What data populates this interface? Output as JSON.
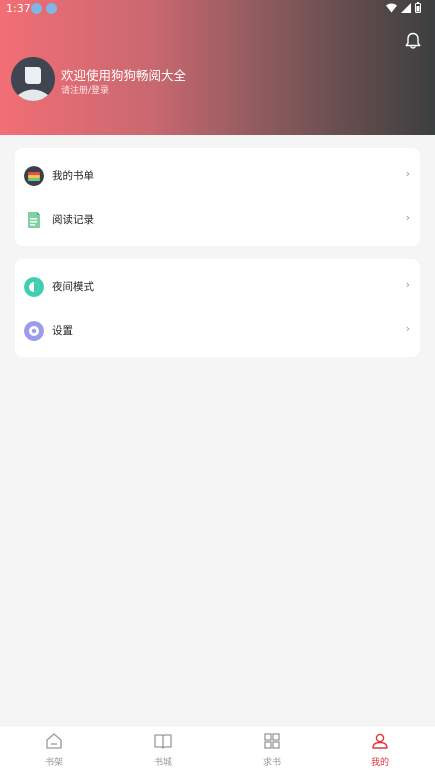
{
  "status_bar": {
    "time": "1:37"
  },
  "profile": {
    "welcome_text": "欢迎使用狗狗畅阅大全",
    "login_text": "请注册/登录"
  },
  "menu_group_1": [
    {
      "label": "我的书单",
      "icon": "book-list-icon"
    },
    {
      "label": "阅读记录",
      "icon": "reading-history-icon"
    }
  ],
  "menu_group_2": [
    {
      "label": "夜间模式",
      "icon": "night-mode-icon"
    },
    {
      "label": "设置",
      "icon": "settings-icon"
    }
  ],
  "tab_bar": [
    {
      "label": "书架",
      "icon": "bookshelf-icon"
    },
    {
      "label": "书城",
      "icon": "book-store-icon"
    },
    {
      "label": "求书",
      "icon": "request-book-icon"
    },
    {
      "label": "我的",
      "icon": "profile-icon",
      "active": true
    }
  ],
  "colors": {
    "header_gradient_start": "#f26e75",
    "header_gradient_end": "#3b3f3f",
    "accent": "#e2363f",
    "background": "#f5f5f5"
  }
}
